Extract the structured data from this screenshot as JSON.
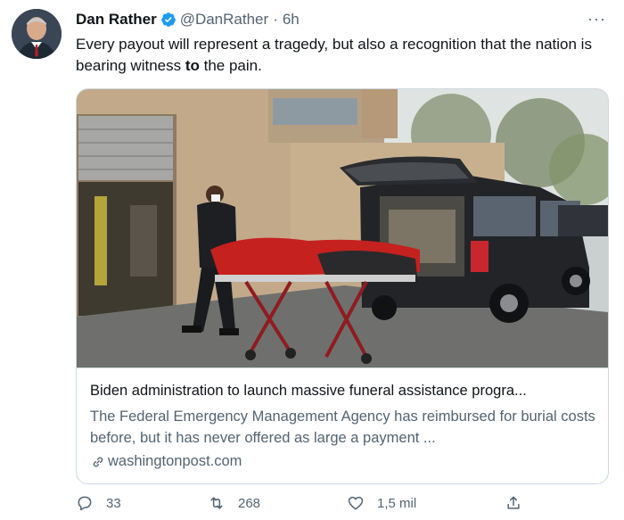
{
  "tweet": {
    "author_name": "Dan Rather",
    "handle": "@DanRather",
    "separator": "·",
    "time": "6h",
    "more_label": "···",
    "text_parts": [
      "Every payout will represent a tragedy, but also a recognition that the nation is bearing witness ",
      "to",
      " the pain."
    ]
  },
  "card": {
    "title": "Biden administration to launch massive funeral assistance progra...",
    "description": "The Federal Emergency Management Agency has reimbursed for burial costs before, but it has never offered as large a payment ...",
    "domain": "washingtonpost.com",
    "image_icon": "photo-garage-stretcher-hearse"
  },
  "actions": {
    "reply_count": "33",
    "retweet_count": "268",
    "like_count": "1,5 mil"
  },
  "colors": {
    "verified": "#1d9bf0",
    "secondary_text": "#536471",
    "border": "#cfd9de"
  },
  "icons": [
    "verified-icon",
    "more-icon",
    "link-icon",
    "reply-icon",
    "retweet-icon",
    "like-icon",
    "share-icon"
  ]
}
